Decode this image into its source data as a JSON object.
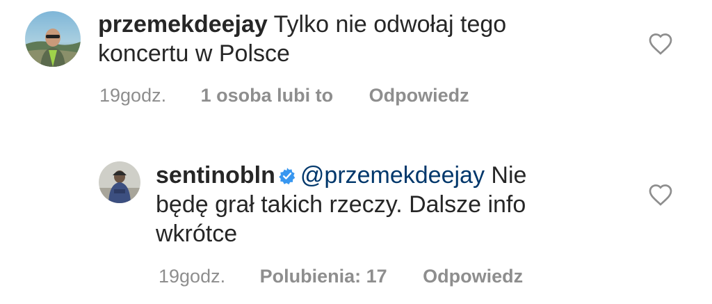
{
  "comments": [
    {
      "username": "przemekdeejay",
      "text": "Tylko nie odwołaj tego koncertu w Polsce",
      "time": "19godz.",
      "likes": "1 osoba lubi to",
      "reply": "Odpowiedz",
      "like_icon": "heart-outline-icon"
    },
    {
      "username": "sentinobln",
      "verified_icon": "verified-badge-icon",
      "mention": "@przemekdeejay",
      "text_line1": "Nie",
      "text_line2": "będę grał takich rzeczy. Dalsze info",
      "text_line3": "wkrótce",
      "time": "19godz.",
      "likes": "Polubienia: 17",
      "reply": "Odpowiedz",
      "like_icon": "heart-outline-icon"
    }
  ],
  "colors": {
    "text": "#262626",
    "secondary": "#8e8e8e",
    "mention": "#00376b",
    "verified": "#3897f0"
  }
}
